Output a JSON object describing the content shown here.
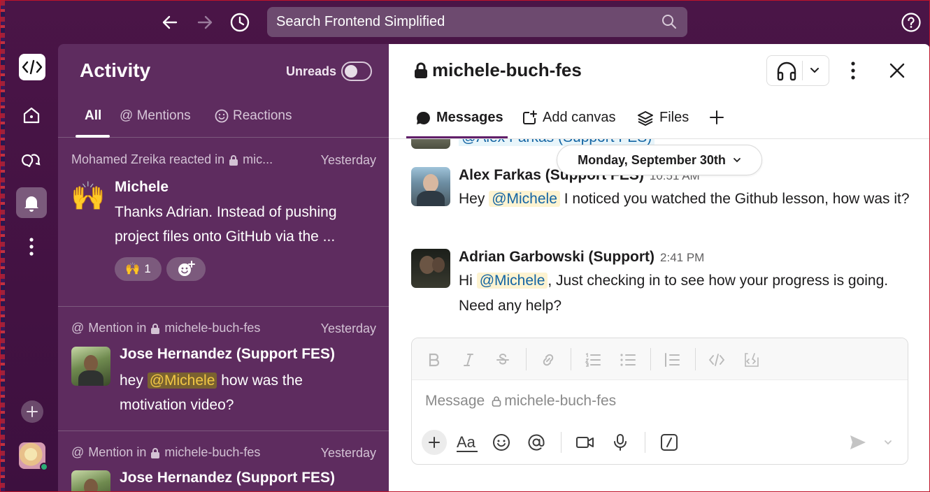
{
  "topbar": {
    "search_placeholder": "Search Frontend Simplified"
  },
  "rail": {
    "workspace_logo": "</>",
    "items": [
      "home-icon",
      "dms-icon",
      "activity-icon",
      "more-icon"
    ]
  },
  "activity": {
    "title": "Activity",
    "unreads_label": "Unreads",
    "unreads_on": false,
    "tabs": [
      {
        "label": "All"
      },
      {
        "label": "@ Mentions"
      },
      {
        "label": "Reactions"
      }
    ],
    "items": [
      {
        "meta": "Mohamed Zreika reacted in",
        "channel": "mic...",
        "time": "Yesterday",
        "emoji": "🙌",
        "name": "Michele",
        "text": "Thanks Adrian. Instead of pushing project files onto GitHub via the ...",
        "reaction_emoji": "🙌",
        "reaction_count": "1"
      },
      {
        "meta": "Mention in",
        "channel": "michele-buch-fes",
        "time": "Yesterday",
        "name": "Jose Hernandez (Support FES)",
        "text_before": "hey",
        "mention": "@Michele",
        "text_after": "how was the motivation video?"
      },
      {
        "meta": "Mention in",
        "channel": "michele-buch-fes",
        "time": "Yesterday",
        "name": "Jose Hernandez (Support FES)"
      }
    ]
  },
  "channel": {
    "name": "michele-buch-fes",
    "tabs": [
      {
        "label": "Messages"
      },
      {
        "label": "Add canvas"
      },
      {
        "label": "Files"
      }
    ],
    "partial_message": "@Alex Farkas (Support FES)",
    "date_divider": "Monday, September 30th",
    "messages": [
      {
        "author": "Alex Farkas (Support FES)",
        "time": "10:51 AM",
        "text_before": "Hey",
        "mention": "@Michele",
        "text_after": "I noticed you watched the Github lesson, how was it?"
      },
      {
        "author": "Adrian Garbowski (Support)",
        "time": "2:41 PM",
        "text_before": "Hi",
        "mention": "@Michele",
        "text_after": ", Just checking in to see how your progress is going. Need any help?"
      }
    ],
    "composer": {
      "placeholder": "Message",
      "placeholder_channel": "michele-buch-fes",
      "format_buttons": [
        "bold",
        "italic",
        "strikethrough",
        "link",
        "ordered-list",
        "bulleted-list",
        "blockquote",
        "code",
        "code-block"
      ]
    }
  },
  "colors": {
    "aubergine": "#3f0e40",
    "activity_bg": "#5e2c5f",
    "mention_link": "#1264a3",
    "mention_bg": "#fdf3d1",
    "mention_yellow": "#f2c744",
    "presence_green": "#2bac76"
  }
}
